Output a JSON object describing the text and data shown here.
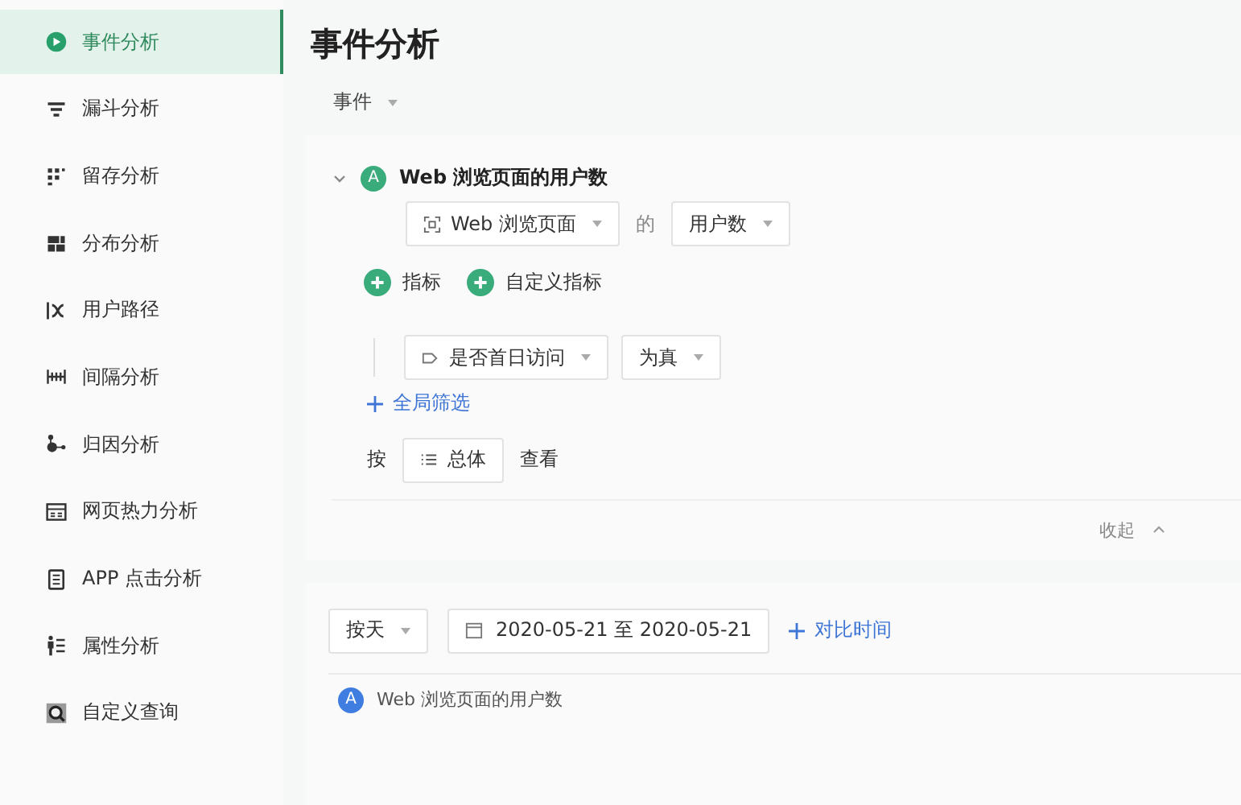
{
  "sidebar": {
    "items": [
      {
        "label": "事件分析",
        "selected": true
      },
      {
        "label": "漏斗分析",
        "selected": false
      },
      {
        "label": "留存分析",
        "selected": false
      },
      {
        "label": "分布分析",
        "selected": false
      },
      {
        "label": "用户路径",
        "selected": false
      },
      {
        "label": "间隔分析",
        "selected": false
      },
      {
        "label": "归因分析",
        "selected": false
      },
      {
        "label": "网页热力分析",
        "selected": false
      },
      {
        "label": "APP 点击分析",
        "selected": false
      },
      {
        "label": "属性分析",
        "selected": false
      },
      {
        "label": "自定义查询",
        "selected": false
      }
    ]
  },
  "page": {
    "title": "事件分析",
    "type_dropdown": "事件"
  },
  "query": {
    "metric": {
      "badge": "A",
      "name": "Web 浏览页面的用户数",
      "event": "Web 浏览页面",
      "connector": "的",
      "measure": "用户数"
    },
    "add_buttons": [
      "指标",
      "自定义指标"
    ],
    "filter": {
      "property": "是否首日访问",
      "operator": "为真"
    },
    "global_filter": "全局筛选",
    "group_by": {
      "prefix": "按",
      "value": "总体",
      "suffix": "查看"
    },
    "collapse": "收起"
  },
  "results": {
    "granularity": "按天",
    "date_range": "2020-05-21 至 2020-05-21",
    "compare": "对比时间",
    "legend": {
      "badge": "A",
      "label": "Web 浏览页面的用户数"
    }
  }
}
